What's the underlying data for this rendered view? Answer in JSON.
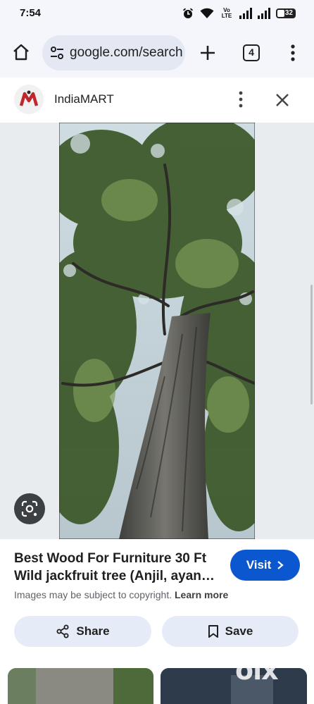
{
  "status_bar": {
    "time": "7:54",
    "network_label": "Vo LTE",
    "battery": "32",
    "icons": [
      "alarm-icon",
      "wifi-icon",
      "signal-icon",
      "signal-icon",
      "battery-icon"
    ]
  },
  "toolbar": {
    "url": "google.com/search",
    "tab_count": "4",
    "icons": [
      "home-icon",
      "site-settings-icon",
      "plus-icon",
      "tabs-icon",
      "more-vert-icon"
    ]
  },
  "source": {
    "name": "IndiaMART",
    "logo_letter": "M",
    "icons": [
      "indiamart-logo",
      "more-vert-icon",
      "close-icon"
    ]
  },
  "viewer": {
    "lens_icon": "google-lens-icon"
  },
  "result": {
    "title": "Best Wood For Furniture 30 Ft Wild jackfruit tree (Anjil, ayan…",
    "visit_label": "Visit",
    "copyright_text": "Images may be subject to copyright.",
    "learn_more": "Learn more",
    "share_label": "Share",
    "save_label": "Save",
    "watermark": "olx"
  },
  "colors": {
    "accent": "#0b57d0",
    "chip_bg": "#e6ecf7",
    "toolbar_bg": "#f4f6fb",
    "brand_red": "#c0272d"
  }
}
